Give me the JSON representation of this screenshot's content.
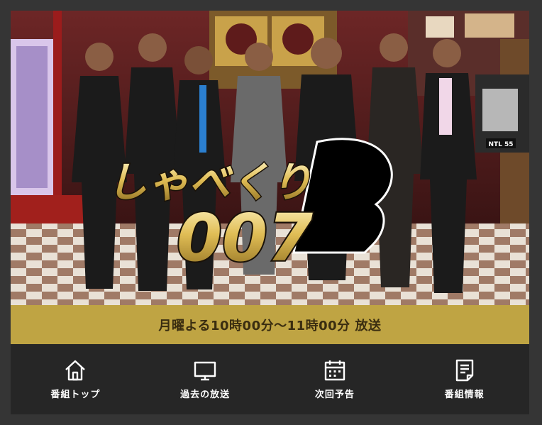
{
  "program": {
    "logo_line1": "しゃべくり",
    "logo_line2": "007",
    "car_plate": "NTL 55"
  },
  "airtime": {
    "text": "月曜よる10時00分～11時00分 放送"
  },
  "nav": {
    "items": [
      {
        "label": "番組トップ",
        "icon": "home-icon"
      },
      {
        "label": "過去の放送",
        "icon": "tv-icon"
      },
      {
        "label": "次回予告",
        "icon": "calendar-icon"
      },
      {
        "label": "番組情報",
        "icon": "document-icon"
      }
    ]
  },
  "colors": {
    "accent_gold": "#bfa443",
    "nav_bg": "#262626",
    "page_bg": "#353535"
  }
}
